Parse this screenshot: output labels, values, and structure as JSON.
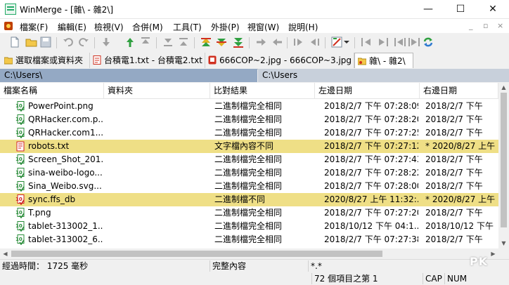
{
  "window": {
    "title": "WinMerge - [雜\\ - 雜2\\]",
    "minimize_glyph": "—",
    "maximize_glyph": "☐",
    "close_glyph": "✕"
  },
  "menu": {
    "items": [
      "檔案(F)",
      "編輯(E)",
      "檢視(V)",
      "合併(M)",
      "工具(T)",
      "外掛(P)",
      "視窗(W)",
      "說明(H)"
    ],
    "mdi_minimize": "_",
    "mdi_restore": "▫",
    "mdi_close": "×"
  },
  "toolbar": {
    "icons": [
      "new-icon",
      "open-icon",
      "save-icon",
      "undo-icon",
      "redo-icon",
      "next-diff-icon",
      "prev-diff-icon",
      "first-diff-icon",
      "last-diff-icon",
      "current-diff-icon",
      "next-conflict-icon",
      "prev-conflict-icon",
      "copy-right-icon",
      "copy-left-icon",
      "copy-right-advance-icon",
      "copy-left-advance-icon",
      "all-right-icon",
      "all-left-icon",
      "options-icon",
      "dropdown-icon",
      "left-only-icon",
      "right-only-icon",
      "compare-icon",
      "refresh-icon"
    ]
  },
  "tabs": [
    {
      "label": "選取檔案或資料夾",
      "icon": "select-files-icon"
    },
    {
      "label": "台積電1.txt - 台積電2.txt",
      "icon": "text-file-icon"
    },
    {
      "label": "666COP~2.jpg - 666COP~3.jpg",
      "icon": "image-file-icon"
    },
    {
      "label": "雜\\ - 雜2\\",
      "icon": "folder-compare-icon"
    }
  ],
  "paths": {
    "left": "C:\\Users\\",
    "right": "C:\\Users"
  },
  "columns": [
    "檔案名稱",
    "資料夾",
    "比對結果",
    "左邊日期",
    "右邊日期"
  ],
  "rows": [
    {
      "name": "PowerPoint.png",
      "folder": "",
      "result": "二進制檔完全相同",
      "left_date": "2018/2/7 下午 07:28:09",
      "right_date": "2018/2/7 下午",
      "diff": false
    },
    {
      "name": "QRHacker.com.p...",
      "folder": "",
      "result": "二進制檔完全相同",
      "left_date": "2018/2/7 下午 07:28:20",
      "right_date": "2018/2/7 下午",
      "diff": false
    },
    {
      "name": "QRHacker.com1....",
      "folder": "",
      "result": "二進制檔完全相同",
      "left_date": "2018/2/7 下午 07:27:25",
      "right_date": "2018/2/7 下午",
      "diff": false
    },
    {
      "name": "robots.txt",
      "folder": "",
      "result": "文字檔內容不同",
      "left_date": "2018/2/7 下午 07:27:12",
      "right_date": "* 2020/8/27 上午 1",
      "diff": true
    },
    {
      "name": "Screen_Shot_201...",
      "folder": "",
      "result": "二進制檔完全相同",
      "left_date": "2018/2/7 下午 07:27:43",
      "right_date": "2018/2/7 下午",
      "diff": false
    },
    {
      "name": "sina-weibo-logo....",
      "folder": "",
      "result": "二進制檔完全相同",
      "left_date": "2018/2/7 下午 07:28:22",
      "right_date": "2018/2/7 下午",
      "diff": false
    },
    {
      "name": "Sina_Weibo.svg....",
      "folder": "",
      "result": "二進制檔完全相同",
      "left_date": "2018/2/7 下午 07:28:00",
      "right_date": "2018/2/7 下午",
      "diff": false
    },
    {
      "name": "sync.ffs_db",
      "folder": "",
      "result": "二進制檔不同",
      "left_date": "2020/8/27 上午 11:32:...",
      "right_date": "* 2020/8/27 上午 1",
      "diff": true
    },
    {
      "name": "T.png",
      "folder": "",
      "result": "二進制檔完全相同",
      "left_date": "2018/2/7 下午 07:27:20",
      "right_date": "2018/2/7 下午",
      "diff": false
    },
    {
      "name": "tablet-313002_1...",
      "folder": "",
      "result": "二進制檔完全相同",
      "left_date": "2018/10/12 下午 04:1...",
      "right_date": "2018/10/12 下午",
      "diff": false
    },
    {
      "name": "tablet-313002_6...",
      "folder": "",
      "result": "二進制檔完全相同",
      "left_date": "2018/2/7 下午 07:27:38",
      "right_date": "2018/2/7 下午",
      "diff": false
    }
  ],
  "status": {
    "elapsed": "經過時間： 1725 毫秒",
    "compare_mode": "完整內容",
    "filter": "*.*",
    "item_count": "72 個項目之第 1",
    "cap": "CAP",
    "num": "NUM"
  },
  "watermark": "PK",
  "colors": {
    "diff_row": "#efdf86",
    "path_left_bg": "#94a9c4",
    "path_right_bg": "#c8d0db",
    "identical_icon": "#2a8c3a",
    "different_icon": "#d02020"
  }
}
